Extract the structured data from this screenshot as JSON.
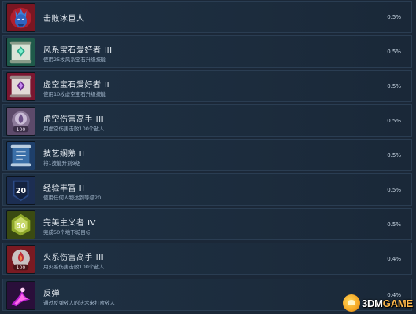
{
  "achievements": [
    {
      "title": "击败冰巨人",
      "desc": "",
      "percent": "0.5%",
      "icon": "ice-giant-icon"
    },
    {
      "title": "风系宝石爱好者 III",
      "desc": "使用25枚风系宝石升级技能",
      "percent": "0.5%",
      "icon": "wind-gem-scroll-icon"
    },
    {
      "title": "虚空宝石爱好者 II",
      "desc": "使用10枚虚空宝石升级技能",
      "percent": "0.5%",
      "icon": "void-gem-scroll-icon"
    },
    {
      "title": "虚空伤害高手 III",
      "desc": "用虚空伤害击败100个敌人",
      "percent": "0.5%",
      "icon": "void-damage-100-icon"
    },
    {
      "title": "技艺娴熟 II",
      "desc": "将1技能升到9级",
      "percent": "0.5%",
      "icon": "skill-scroll-icon"
    },
    {
      "title": "经验丰富 II",
      "desc": "使用任何人物达到等级20",
      "percent": "0.5%",
      "icon": "level-20-badge-icon"
    },
    {
      "title": "完美主义者 IV",
      "desc": "完成50个地下城目标",
      "percent": "0.5%",
      "icon": "perfectionist-50-icon"
    },
    {
      "title": "火系伤害高手 III",
      "desc": "用火系伤害击败100个敌人",
      "percent": "0.4%",
      "icon": "fire-damage-100-icon"
    },
    {
      "title": "反弹",
      "desc": "通过反弹敌人的法术来打败敌人",
      "percent": "0.4%",
      "icon": "reflect-spell-icon"
    }
  ],
  "watermark": {
    "part1": "3DM",
    "part2": "GAME"
  }
}
